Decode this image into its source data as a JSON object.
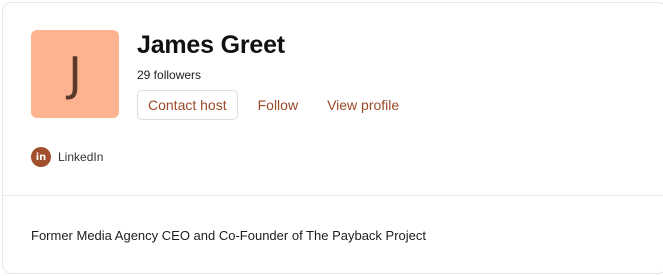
{
  "host": {
    "avatar_initial": "J",
    "avatar_color": "#fdb38f",
    "name": "James Greet",
    "followers": "29 followers",
    "bio": "Former Media Agency CEO and Co-Founder of The Payback Project"
  },
  "actions": {
    "contact_label": "Contact host",
    "follow_label": "Follow",
    "view_profile_label": "View profile"
  },
  "social": {
    "icon": "linkedin-icon",
    "icon_glyph": "in",
    "label": "LinkedIn"
  },
  "colors": {
    "accent": "#9a4a28",
    "linkedin_badge": "#a04e2c"
  }
}
